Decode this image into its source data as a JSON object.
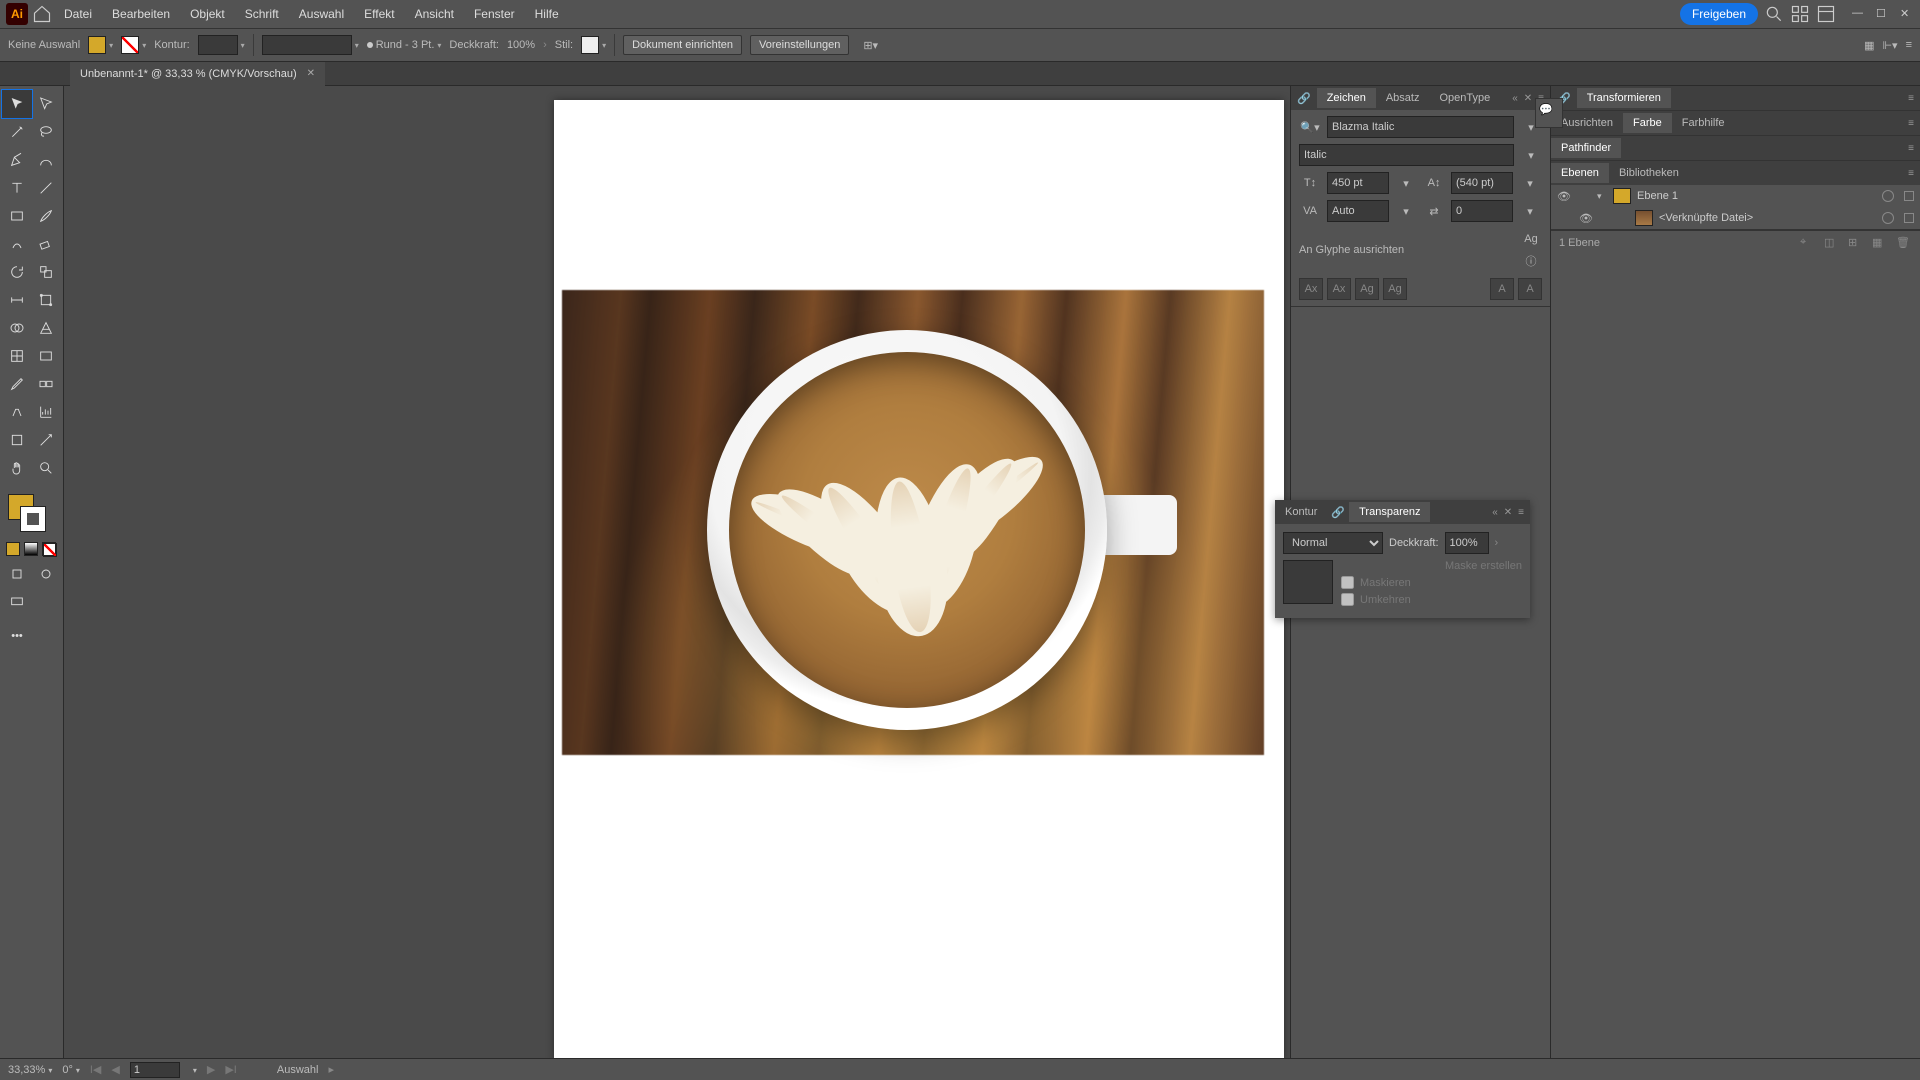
{
  "app": {
    "logo": "Ai"
  },
  "menu": {
    "items": [
      "Datei",
      "Bearbeiten",
      "Objekt",
      "Schrift",
      "Auswahl",
      "Effekt",
      "Ansicht",
      "Fenster",
      "Hilfe"
    ],
    "share": "Freigeben"
  },
  "controlbar": {
    "no_selection": "Keine Auswahl",
    "fill_color": "#d4a82a",
    "stroke_label": "Kontur:",
    "stroke_weight": "",
    "brush_label": "Rund - 3 Pt.",
    "opacity_label": "Deckkraft:",
    "opacity_value": "100%",
    "style_label": "Stil:",
    "doc_setup": "Dokument einrichten",
    "preferences": "Voreinstellungen"
  },
  "document": {
    "tab_title": "Unbenannt-1* @ 33,33 % (CMYK/Vorschau)"
  },
  "char_panel": {
    "tabs": [
      "Zeichen",
      "Absatz",
      "OpenType"
    ],
    "font": "Blazma Italic",
    "style": "Italic",
    "size": "450 pt",
    "leading": "(540 pt)",
    "kerning": "Auto",
    "tracking": "0",
    "glyph_snap": "An Glyphe ausrichten"
  },
  "trans_panel": {
    "tabs": [
      "Kontur",
      "Transparenz"
    ],
    "blend": "Normal",
    "opacity_label": "Deckkraft:",
    "opacity_value": "100%",
    "mask_create": "Maske erstellen",
    "mask_clip": "Maskieren",
    "mask_invert": "Umkehren"
  },
  "right_tabs": {
    "row1": [
      "Transformieren"
    ],
    "row2": [
      "Ausrichten",
      "Farbe",
      "Farbhilfe"
    ],
    "row2_active": "Farbe",
    "pathfinder": "Pathfinder",
    "row3": [
      "Ebenen",
      "Bibliotheken"
    ],
    "row3_active": "Ebenen"
  },
  "layers": {
    "items": [
      {
        "name": "Ebene 1",
        "expanded": true
      },
      {
        "name": "<Verknüpfte Datei>",
        "child": true
      }
    ],
    "footer": "1 Ebene"
  },
  "status": {
    "zoom": "33,33%",
    "rotate": "0°",
    "artboard_nav": "1",
    "tool": "Auswahl"
  }
}
